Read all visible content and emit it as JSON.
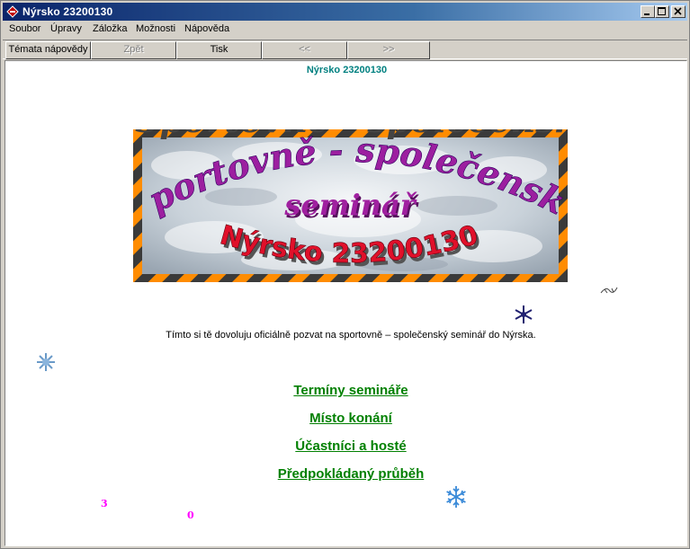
{
  "window": {
    "title": "Nýrsko 23200130"
  },
  "menubar": {
    "items": [
      {
        "label": "Soubor"
      },
      {
        "label": "Úpravy"
      },
      {
        "label": "Záložka"
      },
      {
        "label": "Možnosti"
      },
      {
        "label": "Nápověda"
      }
    ]
  },
  "toolbar": {
    "topics": "Témata nápovědy",
    "back": "Zpět",
    "print": "Tisk",
    "prev": "<<",
    "next": ">>"
  },
  "page": {
    "title": "Nýrsko 23200130",
    "banner": {
      "line1": "Sportovně - společensky",
      "line2": "seminář",
      "line3": "Nýrsko 23200130"
    },
    "invite": "Tímto si tě dovoluju oficiálně pozvat na sportovně – společenský seminář do Nýrska.",
    "links": [
      {
        "label": "Termíny semináře"
      },
      {
        "label": "Místo konání"
      },
      {
        "label": "Účastníci a hosté"
      },
      {
        "label": "Předpokládaný průběh"
      }
    ],
    "counters": [
      {
        "value": "3"
      },
      {
        "value": "0"
      }
    ]
  }
}
